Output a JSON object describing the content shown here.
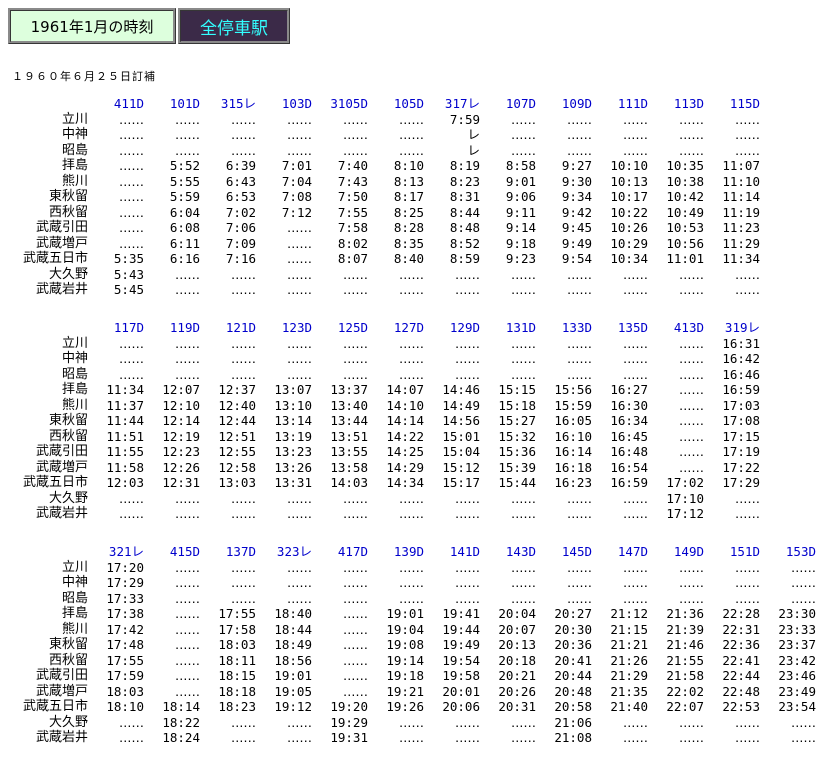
{
  "header": {
    "title": "1961年1月の時刻",
    "tag": "全停車駅"
  },
  "note": "１９６０年６月２５日訂補",
  "stations": [
    "立川",
    "中神",
    "昭島",
    "拝島",
    "熊川",
    "東秋留",
    "西秋留",
    "武蔵引田",
    "武蔵増戸",
    "武蔵五日市",
    "大久野",
    "武蔵岩井"
  ],
  "blocks": [
    {
      "trains": [
        "411D",
        "101D",
        "315レ",
        "103D",
        "3105D",
        "105D",
        "317レ",
        "107D",
        "109D",
        "111D",
        "113D",
        "115D"
      ],
      "rows": [
        [
          "‥‥‥",
          "‥‥‥",
          "‥‥‥",
          "‥‥‥",
          "‥‥‥",
          "‥‥‥",
          "7:59",
          "‥‥‥",
          "‥‥‥",
          "‥‥‥",
          "‥‥‥",
          "‥‥‥"
        ],
        [
          "‥‥‥",
          "‥‥‥",
          "‥‥‥",
          "‥‥‥",
          "‥‥‥",
          "‥‥‥",
          "レ",
          "‥‥‥",
          "‥‥‥",
          "‥‥‥",
          "‥‥‥",
          "‥‥‥"
        ],
        [
          "‥‥‥",
          "‥‥‥",
          "‥‥‥",
          "‥‥‥",
          "‥‥‥",
          "‥‥‥",
          "レ",
          "‥‥‥",
          "‥‥‥",
          "‥‥‥",
          "‥‥‥",
          "‥‥‥"
        ],
        [
          "‥‥‥",
          "5:52",
          "6:39",
          "7:01",
          "7:40",
          "8:10",
          "8:19",
          "8:58",
          "9:27",
          "10:10",
          "10:35",
          "11:07"
        ],
        [
          "‥‥‥",
          "5:55",
          "6:43",
          "7:04",
          "7:43",
          "8:13",
          "8:23",
          "9:01",
          "9:30",
          "10:13",
          "10:38",
          "11:10"
        ],
        [
          "‥‥‥",
          "5:59",
          "6:53",
          "7:08",
          "7:50",
          "8:17",
          "8:31",
          "9:06",
          "9:34",
          "10:17",
          "10:42",
          "11:14"
        ],
        [
          "‥‥‥",
          "6:04",
          "7:02",
          "7:12",
          "7:55",
          "8:25",
          "8:44",
          "9:11",
          "9:42",
          "10:22",
          "10:49",
          "11:19"
        ],
        [
          "‥‥‥",
          "6:08",
          "7:06",
          "‥‥‥",
          "7:58",
          "8:28",
          "8:48",
          "9:14",
          "9:45",
          "10:26",
          "10:53",
          "11:23"
        ],
        [
          "‥‥‥",
          "6:11",
          "7:09",
          "‥‥‥",
          "8:02",
          "8:35",
          "8:52",
          "9:18",
          "9:49",
          "10:29",
          "10:56",
          "11:29"
        ],
        [
          "5:35",
          "6:16",
          "7:16",
          "‥‥‥",
          "8:07",
          "8:40",
          "8:59",
          "9:23",
          "9:54",
          "10:34",
          "11:01",
          "11:34"
        ],
        [
          "5:43",
          "‥‥‥",
          "‥‥‥",
          "‥‥‥",
          "‥‥‥",
          "‥‥‥",
          "‥‥‥",
          "‥‥‥",
          "‥‥‥",
          "‥‥‥",
          "‥‥‥",
          "‥‥‥"
        ],
        [
          "5:45",
          "‥‥‥",
          "‥‥‥",
          "‥‥‥",
          "‥‥‥",
          "‥‥‥",
          "‥‥‥",
          "‥‥‥",
          "‥‥‥",
          "‥‥‥",
          "‥‥‥",
          "‥‥‥"
        ]
      ]
    },
    {
      "trains": [
        "117D",
        "119D",
        "121D",
        "123D",
        "125D",
        "127D",
        "129D",
        "131D",
        "133D",
        "135D",
        "413D",
        "319レ"
      ],
      "rows": [
        [
          "‥‥‥",
          "‥‥‥",
          "‥‥‥",
          "‥‥‥",
          "‥‥‥",
          "‥‥‥",
          "‥‥‥",
          "‥‥‥",
          "‥‥‥",
          "‥‥‥",
          "‥‥‥",
          "16:31"
        ],
        [
          "‥‥‥",
          "‥‥‥",
          "‥‥‥",
          "‥‥‥",
          "‥‥‥",
          "‥‥‥",
          "‥‥‥",
          "‥‥‥",
          "‥‥‥",
          "‥‥‥",
          "‥‥‥",
          "16:42"
        ],
        [
          "‥‥‥",
          "‥‥‥",
          "‥‥‥",
          "‥‥‥",
          "‥‥‥",
          "‥‥‥",
          "‥‥‥",
          "‥‥‥",
          "‥‥‥",
          "‥‥‥",
          "‥‥‥",
          "16:46"
        ],
        [
          "11:34",
          "12:07",
          "12:37",
          "13:07",
          "13:37",
          "14:07",
          "14:46",
          "15:15",
          "15:56",
          "16:27",
          "‥‥‥",
          "16:59"
        ],
        [
          "11:37",
          "12:10",
          "12:40",
          "13:10",
          "13:40",
          "14:10",
          "14:49",
          "15:18",
          "15:59",
          "16:30",
          "‥‥‥",
          "17:03"
        ],
        [
          "11:44",
          "12:14",
          "12:44",
          "13:14",
          "13:44",
          "14:14",
          "14:56",
          "15:27",
          "16:05",
          "16:34",
          "‥‥‥",
          "17:08"
        ],
        [
          "11:51",
          "12:19",
          "12:51",
          "13:19",
          "13:51",
          "14:22",
          "15:01",
          "15:32",
          "16:10",
          "16:45",
          "‥‥‥",
          "17:15"
        ],
        [
          "11:55",
          "12:23",
          "12:55",
          "13:23",
          "13:55",
          "14:25",
          "15:04",
          "15:36",
          "16:14",
          "16:48",
          "‥‥‥",
          "17:19"
        ],
        [
          "11:58",
          "12:26",
          "12:58",
          "13:26",
          "13:58",
          "14:29",
          "15:12",
          "15:39",
          "16:18",
          "16:54",
          "‥‥‥",
          "17:22"
        ],
        [
          "12:03",
          "12:31",
          "13:03",
          "13:31",
          "14:03",
          "14:34",
          "15:17",
          "15:44",
          "16:23",
          "16:59",
          "17:02",
          "17:29"
        ],
        [
          "‥‥‥",
          "‥‥‥",
          "‥‥‥",
          "‥‥‥",
          "‥‥‥",
          "‥‥‥",
          "‥‥‥",
          "‥‥‥",
          "‥‥‥",
          "‥‥‥",
          "17:10",
          "‥‥‥"
        ],
        [
          "‥‥‥",
          "‥‥‥",
          "‥‥‥",
          "‥‥‥",
          "‥‥‥",
          "‥‥‥",
          "‥‥‥",
          "‥‥‥",
          "‥‥‥",
          "‥‥‥",
          "17:12",
          "‥‥‥"
        ]
      ]
    },
    {
      "trains": [
        "321レ",
        "415D",
        "137D",
        "323レ",
        "417D",
        "139D",
        "141D",
        "143D",
        "145D",
        "147D",
        "149D",
        "151D",
        "153D"
      ],
      "rows": [
        [
          "17:20",
          "‥‥‥",
          "‥‥‥",
          "‥‥‥",
          "‥‥‥",
          "‥‥‥",
          "‥‥‥",
          "‥‥‥",
          "‥‥‥",
          "‥‥‥",
          "‥‥‥",
          "‥‥‥",
          "‥‥‥"
        ],
        [
          "17:29",
          "‥‥‥",
          "‥‥‥",
          "‥‥‥",
          "‥‥‥",
          "‥‥‥",
          "‥‥‥",
          "‥‥‥",
          "‥‥‥",
          "‥‥‥",
          "‥‥‥",
          "‥‥‥",
          "‥‥‥"
        ],
        [
          "17:33",
          "‥‥‥",
          "‥‥‥",
          "‥‥‥",
          "‥‥‥",
          "‥‥‥",
          "‥‥‥",
          "‥‥‥",
          "‥‥‥",
          "‥‥‥",
          "‥‥‥",
          "‥‥‥",
          "‥‥‥"
        ],
        [
          "17:38",
          "‥‥‥",
          "17:55",
          "18:40",
          "‥‥‥",
          "19:01",
          "19:41",
          "20:04",
          "20:27",
          "21:12",
          "21:36",
          "22:28",
          "23:30"
        ],
        [
          "17:42",
          "‥‥‥",
          "17:58",
          "18:44",
          "‥‥‥",
          "19:04",
          "19:44",
          "20:07",
          "20:30",
          "21:15",
          "21:39",
          "22:31",
          "23:33"
        ],
        [
          "17:48",
          "‥‥‥",
          "18:03",
          "18:49",
          "‥‥‥",
          "19:08",
          "19:49",
          "20:13",
          "20:36",
          "21:21",
          "21:46",
          "22:36",
          "23:37"
        ],
        [
          "17:55",
          "‥‥‥",
          "18:11",
          "18:56",
          "‥‥‥",
          "19:14",
          "19:54",
          "20:18",
          "20:41",
          "21:26",
          "21:55",
          "22:41",
          "23:42"
        ],
        [
          "17:59",
          "‥‥‥",
          "18:15",
          "19:01",
          "‥‥‥",
          "19:18",
          "19:58",
          "20:21",
          "20:44",
          "21:29",
          "21:58",
          "22:44",
          "23:46"
        ],
        [
          "18:03",
          "‥‥‥",
          "18:18",
          "19:05",
          "‥‥‥",
          "19:21",
          "20:01",
          "20:26",
          "20:48",
          "21:35",
          "22:02",
          "22:48",
          "23:49"
        ],
        [
          "18:10",
          "18:14",
          "18:23",
          "19:12",
          "19:20",
          "19:26",
          "20:06",
          "20:31",
          "20:58",
          "21:40",
          "22:07",
          "22:53",
          "23:54"
        ],
        [
          "‥‥‥",
          "18:22",
          "‥‥‥",
          "‥‥‥",
          "19:29",
          "‥‥‥",
          "‥‥‥",
          "‥‥‥",
          "21:06",
          "‥‥‥",
          "‥‥‥",
          "‥‥‥",
          "‥‥‥"
        ],
        [
          "‥‥‥",
          "18:24",
          "‥‥‥",
          "‥‥‥",
          "19:31",
          "‥‥‥",
          "‥‥‥",
          "‥‥‥",
          "21:08",
          "‥‥‥",
          "‥‥‥",
          "‥‥‥",
          "‥‥‥"
        ]
      ]
    }
  ]
}
